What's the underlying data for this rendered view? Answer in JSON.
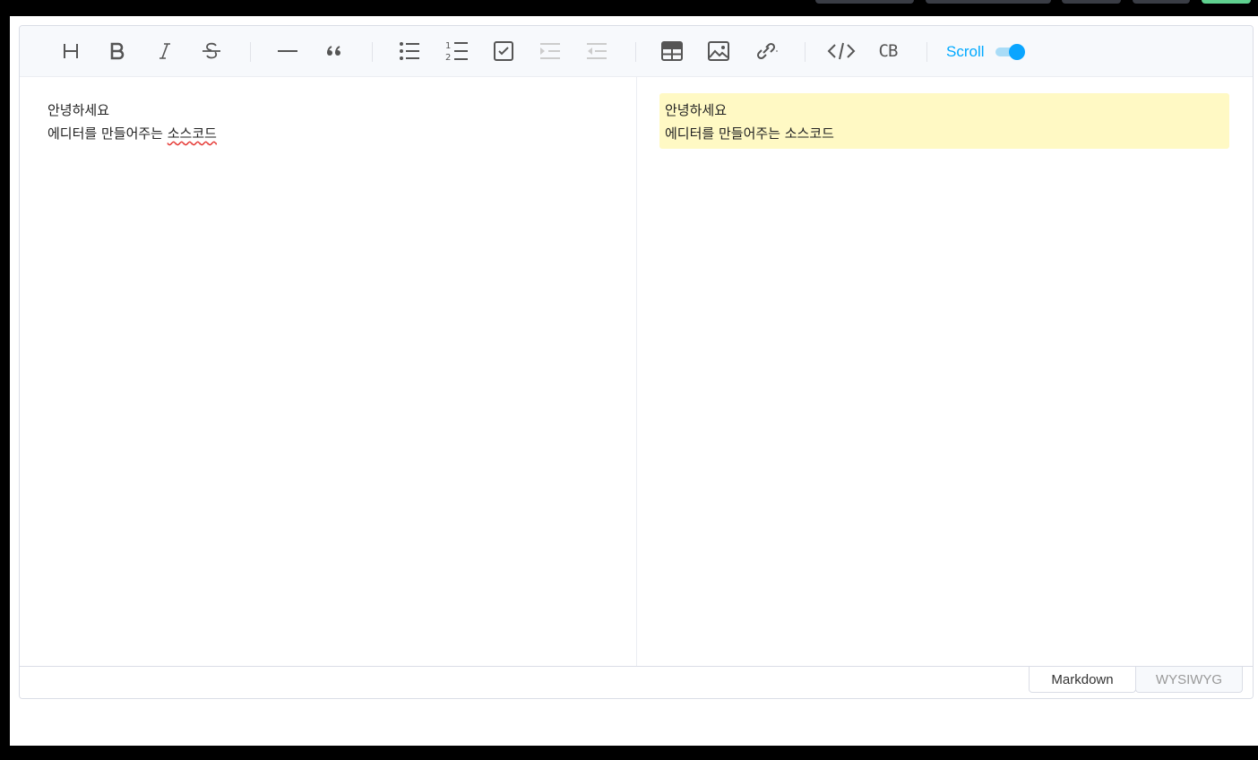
{
  "toolbar": {
    "buttons": [
      {
        "name": "heading",
        "icon": "heading-icon"
      },
      {
        "name": "bold",
        "icon": "bold-icon"
      },
      {
        "name": "italic",
        "icon": "italic-icon"
      },
      {
        "name": "strike",
        "icon": "strikethrough-icon"
      },
      {
        "name": "hr",
        "icon": "horizontal-rule-icon"
      },
      {
        "name": "quote",
        "icon": "quote-icon"
      },
      {
        "name": "bullet-list",
        "icon": "bullet-list-icon"
      },
      {
        "name": "ordered-list",
        "icon": "ordered-list-icon"
      },
      {
        "name": "task",
        "icon": "checkbox-icon"
      },
      {
        "name": "indent",
        "icon": "indent-icon"
      },
      {
        "name": "outdent",
        "icon": "outdent-icon"
      },
      {
        "name": "table",
        "icon": "table-icon"
      },
      {
        "name": "image",
        "icon": "image-icon"
      },
      {
        "name": "link",
        "icon": "link-icon"
      },
      {
        "name": "code",
        "icon": "code-icon"
      },
      {
        "name": "codeblock",
        "icon": "codeblock-icon"
      }
    ],
    "codeblock_label": "CB",
    "scroll_label": "Scroll",
    "scroll_sync_on": true
  },
  "editor": {
    "lines": [
      "안녕하세요",
      "에디터를 만들어주는 "
    ],
    "misspelled_word": "소스코드"
  },
  "preview": {
    "lines": [
      "안녕하세요",
      "에디터를 만들어주는 소스코드"
    ]
  },
  "modes": {
    "markdown": "Markdown",
    "wysiwyg": "WYSIWYG",
    "active": "Markdown"
  },
  "colors": {
    "accent": "#00a9ff",
    "highlight": "#fff9c4"
  }
}
